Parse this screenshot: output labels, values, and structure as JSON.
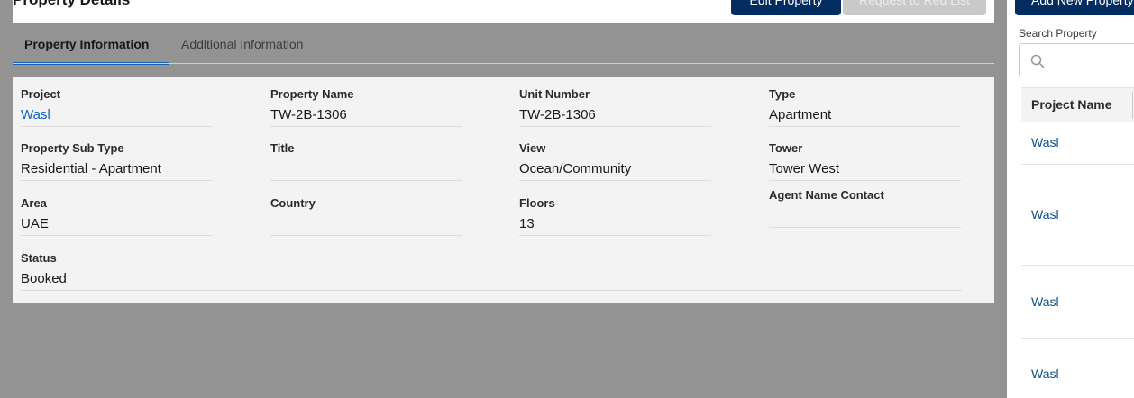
{
  "header": {
    "title": "Property Details",
    "edit_button": "Edit Property",
    "red_list_button": "Request to Red List"
  },
  "tabs": [
    {
      "label": "Property Information",
      "active": true
    },
    {
      "label": "Additional Information",
      "active": false
    }
  ],
  "fields": {
    "project": {
      "label": "Project",
      "value": "Wasl"
    },
    "property_name": {
      "label": "Property Name",
      "value": "TW-2B-1306"
    },
    "unit_number": {
      "label": "Unit Number",
      "value": "TW-2B-1306"
    },
    "type": {
      "label": "Type",
      "value": "Apartment"
    },
    "property_sub_type": {
      "label": "Property Sub Type",
      "value": "Residential - Apartment"
    },
    "title": {
      "label": "Title",
      "value": ""
    },
    "view": {
      "label": "View",
      "value": "Ocean/Community"
    },
    "tower": {
      "label": "Tower",
      "value": "Tower West"
    },
    "area": {
      "label": "Area",
      "value": "UAE"
    },
    "country": {
      "label": "Country",
      "value": ""
    },
    "floors": {
      "label": "Floors",
      "value": "13"
    },
    "agent_name_contact": {
      "label": "Agent Name Contact",
      "value": ""
    },
    "status": {
      "label": "Status",
      "value": "Booked"
    }
  },
  "sidebar": {
    "add_button": "Add New Property",
    "search_label": "Search Property",
    "search_placeholder": "",
    "table_header": "Project Name",
    "rows": [
      "Wasl",
      "Wasl",
      "Wasl",
      "Wasl"
    ]
  },
  "colors": {
    "brand_navy": "#032d60",
    "link_blue": "#0b63c6",
    "tab_underline": "#1b5fb3",
    "overlay_gray": "#939393"
  }
}
